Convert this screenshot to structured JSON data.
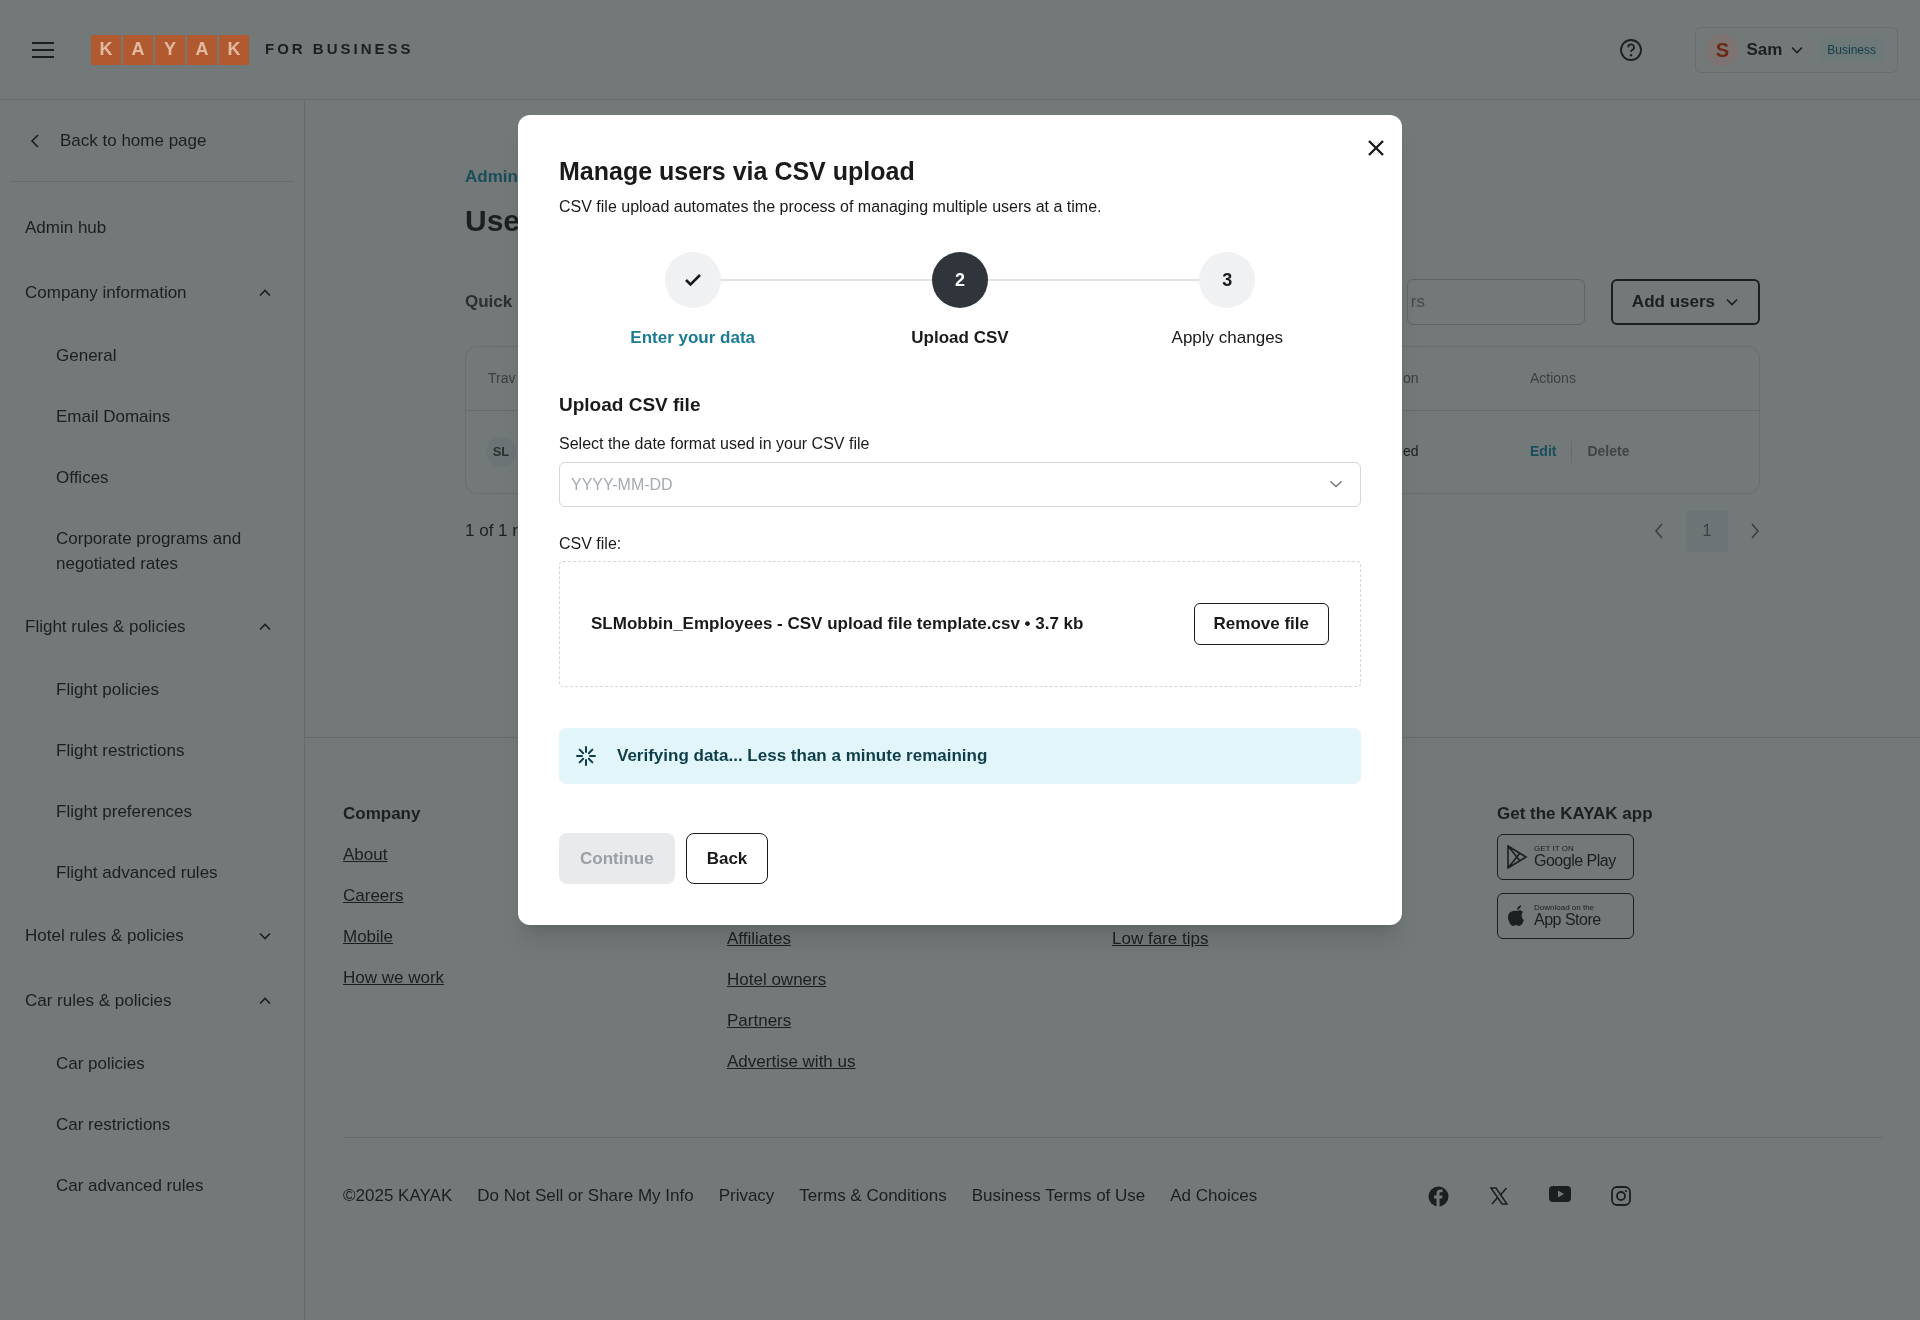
{
  "header": {
    "brand_letters": [
      "K",
      "A",
      "Y",
      "A",
      "K"
    ],
    "brand_suffix": "FOR BUSINESS",
    "account": {
      "initial": "S",
      "name": "Sam",
      "badge": "Business"
    }
  },
  "sidebar": {
    "back_link": "Back to home page",
    "items": [
      {
        "label": "Admin hub"
      },
      {
        "label": "Company information",
        "expanded": true,
        "children": [
          {
            "label": "General"
          },
          {
            "label": "Email Domains"
          },
          {
            "label": "Offices"
          },
          {
            "label": "Corporate programs and negotiated rates"
          }
        ]
      },
      {
        "label": "Flight rules & policies",
        "expanded": true,
        "children": [
          {
            "label": "Flight policies"
          },
          {
            "label": "Flight restrictions"
          },
          {
            "label": "Flight preferences"
          },
          {
            "label": "Flight advanced rules"
          }
        ]
      },
      {
        "label": "Hotel rules & policies",
        "expanded": false
      },
      {
        "label": "Car rules & policies",
        "expanded": true,
        "children": [
          {
            "label": "Car policies"
          },
          {
            "label": "Car restrictions"
          },
          {
            "label": "Car advanced rules"
          }
        ]
      }
    ]
  },
  "main": {
    "breadcrumb": "Admin",
    "title": "Use",
    "quick_label": "Quick",
    "search": {
      "placeholder": "rs"
    },
    "add_button": "Add users",
    "table": {
      "columns": [
        "Trav",
        "on",
        "Actions"
      ],
      "rows": [
        {
          "avatar": "SL",
          "column_2": "ed",
          "actions": [
            {
              "label": "Edit",
              "disabled": false
            },
            {
              "label": "Delete",
              "disabled": true
            }
          ]
        }
      ]
    },
    "pagination": {
      "summary": "1 of 1 r",
      "pages": [
        {
          "label": "1",
          "selected": true
        }
      ]
    }
  },
  "footer": {
    "columns": [
      {
        "heading": "Company",
        "links": [
          "About",
          "Careers",
          "Mobile",
          "How we work"
        ]
      },
      {
        "links": [
          "Affiliates",
          "Hotel owners",
          "Partners",
          "Advertise with us"
        ]
      },
      {
        "links": [
          "Low fare tips"
        ]
      }
    ],
    "app": {
      "heading": "Get the KAYAK app",
      "badges": [
        {
          "kind": "google",
          "small": "GET IT ON",
          "large": "Google Play"
        },
        {
          "kind": "apple",
          "small": "Download on the",
          "large": "App Store"
        }
      ]
    },
    "copyright": "©2025 KAYAK",
    "legal_links": [
      "Do Not Sell or Share My Info",
      "Privacy",
      "Terms & Conditions",
      "Business Terms of Use",
      "Ad Choices"
    ],
    "social": [
      {
        "kind": "facebook"
      },
      {
        "kind": "x"
      },
      {
        "kind": "youtube"
      },
      {
        "kind": "instagram"
      }
    ]
  },
  "modal": {
    "title": "Manage users via CSV upload",
    "subtitle": "CSV file upload automates the process of managing multiple users at a time.",
    "steps": [
      {
        "label": "Enter your data",
        "completed": true,
        "selected": false
      },
      {
        "label": "Upload CSV",
        "number": "2",
        "completed": false,
        "selected": true
      },
      {
        "label": "Apply changes",
        "number": "3",
        "completed": false,
        "selected": false
      }
    ],
    "section_title": "Upload CSV file",
    "date_format": {
      "label": "Select the date format used in your CSV file",
      "placeholder": "YYYY-MM-DD"
    },
    "file": {
      "label": "CSV file:",
      "name": "SLMobbin_Employees - CSV upload file template.csv • 3.7 kb",
      "remove_button": "Remove file"
    },
    "alert": {
      "text": "Verifying data... Less than a minute remaining"
    },
    "actions": [
      {
        "label": "Continue",
        "disabled": true
      },
      {
        "label": "Back",
        "disabled": false
      }
    ]
  }
}
